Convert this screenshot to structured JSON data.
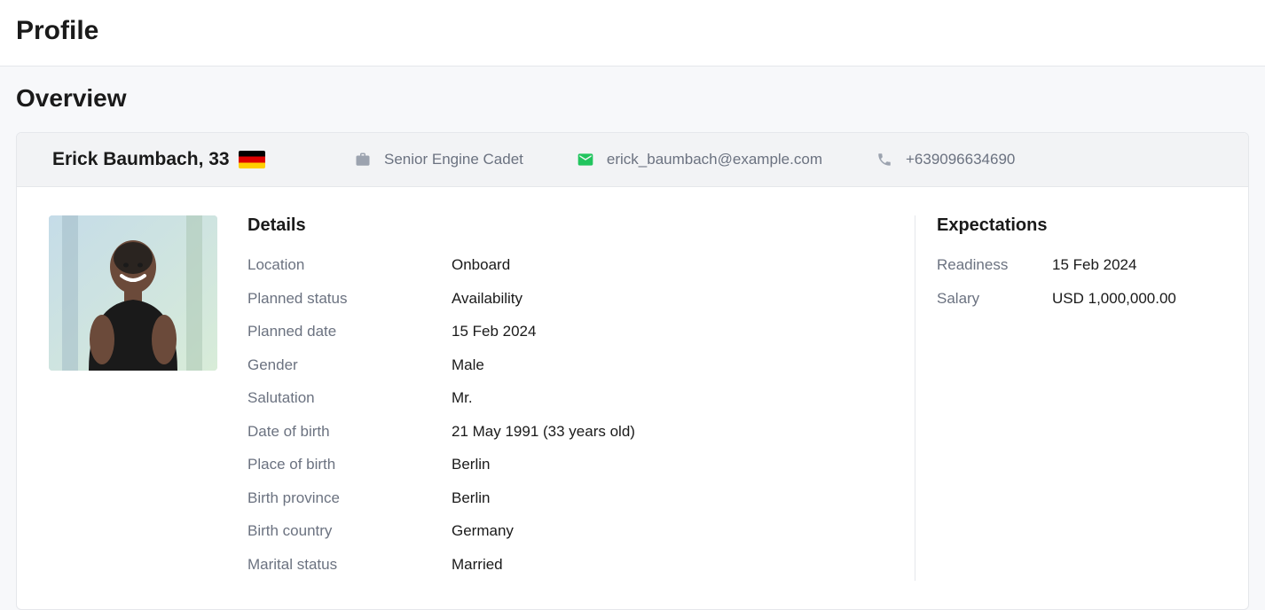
{
  "page": {
    "title": "Profile"
  },
  "overview": {
    "title": "Overview"
  },
  "header": {
    "name": "Erick Baumbach, 33",
    "flag": "de",
    "position": "Senior Engine Cadet",
    "email": "erick_baumbach@example.com",
    "phone": "+639096634690"
  },
  "details": {
    "title": "Details",
    "rows": [
      {
        "key": "Location",
        "val": "Onboard"
      },
      {
        "key": "Planned status",
        "val": "Availability"
      },
      {
        "key": "Planned date",
        "val": "15 Feb 2024"
      },
      {
        "key": "Gender",
        "val": "Male"
      },
      {
        "key": "Salutation",
        "val": "Mr."
      },
      {
        "key": "Date of birth",
        "val": "21 May 1991 (33 years old)"
      },
      {
        "key": "Place of birth",
        "val": "Berlin"
      },
      {
        "key": "Birth province",
        "val": "Berlin"
      },
      {
        "key": "Birth country",
        "val": "Germany"
      },
      {
        "key": "Marital status",
        "val": "Married"
      }
    ]
  },
  "expectations": {
    "title": "Expectations",
    "rows": [
      {
        "key": "Readiness",
        "val": "15 Feb 2024"
      },
      {
        "key": "Salary",
        "val": "USD 1,000,000.00"
      }
    ]
  }
}
